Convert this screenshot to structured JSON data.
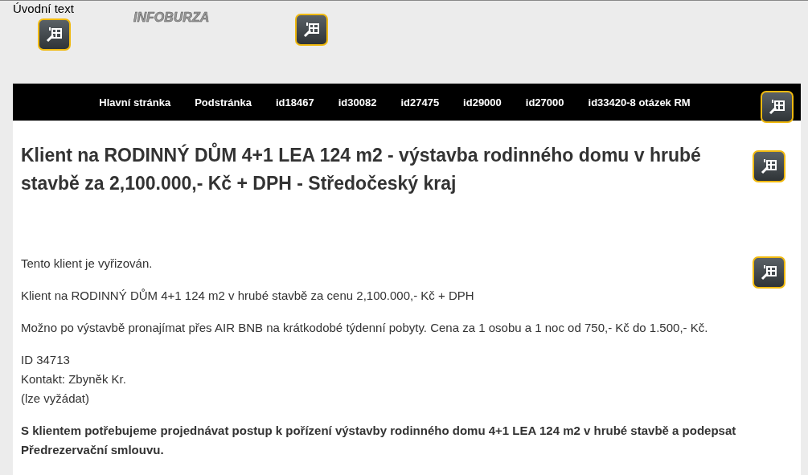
{
  "header": {
    "intro_text": "Úvodní text",
    "logo": "INFOBURZA"
  },
  "nav": {
    "items": [
      {
        "label": "Hlavní stránka"
      },
      {
        "label": "Podstránka"
      },
      {
        "label": "id18467"
      },
      {
        "label": "id30082"
      },
      {
        "label": "id27475"
      },
      {
        "label": "id29000"
      },
      {
        "label": "id27000"
      },
      {
        "label": "id33420-8 otázek RM"
      }
    ]
  },
  "article": {
    "title": "Klient na RODINNÝ DŮM 4+1 LEA 124 m2 - výstavba rodinného domu v hrubé stavbě za 2,100.000,- Kč + DPH - Středočeský kraj",
    "paragraphs": [
      {
        "kind": "plain",
        "lines": [
          "Tento klient je vyřizován."
        ]
      },
      {
        "kind": "plain",
        "lines": [
          "Klient na  RODINNÝ DŮM 4+1  124 m2 v hrubé stavbě za cenu 2,100.000,- Kč + DPH"
        ]
      },
      {
        "kind": "plain",
        "lines": [
          "Možno po výstavbě pronajímat přes AIR BNB na krátkodobé týdenní pobyty. Cena za 1 osobu a 1 noc od 750,- Kč do 1.500,- Kč."
        ]
      },
      {
        "kind": "plain",
        "lines": [
          "ID 34713",
          "Kontakt: Zbyněk Kr.",
          "(lze vyžádat)"
        ]
      },
      {
        "kind": "bold",
        "lines": [
          "S klientem potřebujeme projednávat postup k pořízení výstavby rodinného domu 4+1 LEA 124 m2 v hrubé stavbě a podepsat Předrezervační smlouvu."
        ]
      }
    ]
  }
}
